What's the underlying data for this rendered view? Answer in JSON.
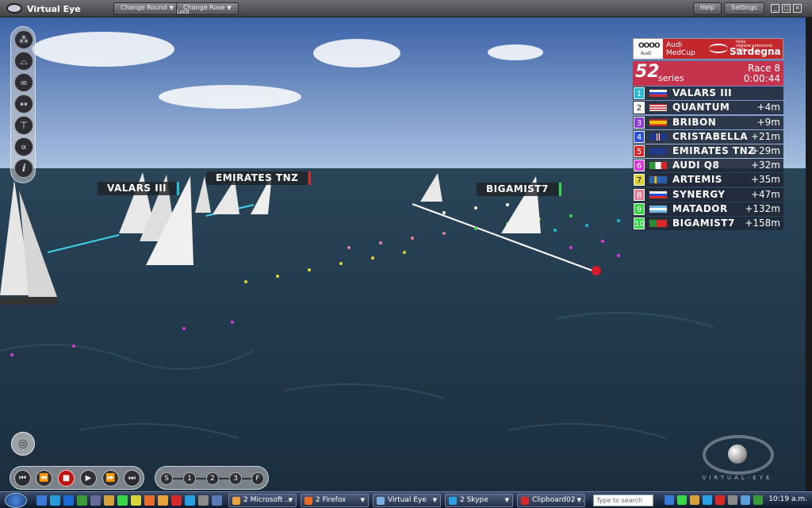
{
  "window": {
    "title": "Virtual Eye",
    "change_round": "Change Round",
    "change_rose": "Change Rose",
    "lock": "Lock",
    "help": "Help",
    "settings": "Settings"
  },
  "tags": {
    "valars": "VALARS III",
    "emirates": "EMIRATES TNZ",
    "bigamist": "BIGAMIST7"
  },
  "leaderboard": {
    "audi": "Audi",
    "audi_rings": "OOOO",
    "medcup_line1": "Audi",
    "medcup_line2": "MedCup",
    "sponsor_region_line1": "Italia",
    "sponsor_region_line2": "regione autonoma della",
    "sponsor_name": "Sardegna",
    "series_number": "52",
    "series_label": "series",
    "race": "Race 8",
    "time": "0:00:44",
    "rows": [
      {
        "pos": "1",
        "name": "VALARS III",
        "gap": "",
        "pos_color": "#2ab7d6",
        "flag": "ru"
      },
      {
        "pos": "2",
        "name": "QUANTUM",
        "gap": "+4m",
        "pos_color": "#ffffff",
        "flag": "us"
      },
      {
        "pos": "3",
        "name": "BRIBON",
        "gap": "+9m",
        "pos_color": "#8a3bd6",
        "flag": "es"
      },
      {
        "pos": "4",
        "name": "CRISTABELLA",
        "gap": "+21m",
        "pos_color": "#2a4fd6",
        "flag": "gb"
      },
      {
        "pos": "5",
        "name": "EMIRATES TNZ",
        "gap": "+29m",
        "pos_color": "#d62a2a",
        "flag": "nz"
      },
      {
        "pos": "6",
        "name": "AUDI Q8",
        "gap": "+32m",
        "pos_color": "#d63ad6",
        "flag": "it"
      },
      {
        "pos": "7",
        "name": "ARTEMIS",
        "gap": "+35m",
        "pos_color": "#e0d23a",
        "flag": "se"
      },
      {
        "pos": "8",
        "name": "SYNERGY",
        "gap": "+47m",
        "pos_color": "#e0809a",
        "flag": "ru"
      },
      {
        "pos": "9",
        "name": "MATADOR",
        "gap": "+132m",
        "pos_color": "#3ad64a",
        "flag": "ar"
      },
      {
        "pos": "10",
        "name": "BIGAMIST7",
        "gap": "+158m",
        "pos_color": "#3ad64a",
        "flag": "pt"
      }
    ]
  },
  "speed": {
    "labels": [
      "S",
      "1",
      "2",
      "3",
      "F"
    ]
  },
  "brand": {
    "text": "VIRTUAL-EYE"
  },
  "taskbar": {
    "tasks": [
      {
        "label": "2 Microsoft ...",
        "color": "#e8a33a"
      },
      {
        "label": "2 Firefox",
        "color": "#e86a2a"
      },
      {
        "label": "Virtual Eye",
        "color": "#7ab0e0"
      },
      {
        "label": "2 Skype",
        "color": "#2aa0e0"
      },
      {
        "label": "Clipboard02 - ...",
        "color": "#d62a2a"
      }
    ],
    "search_placeholder": "Type to search",
    "clock": "10:19 a.m."
  }
}
